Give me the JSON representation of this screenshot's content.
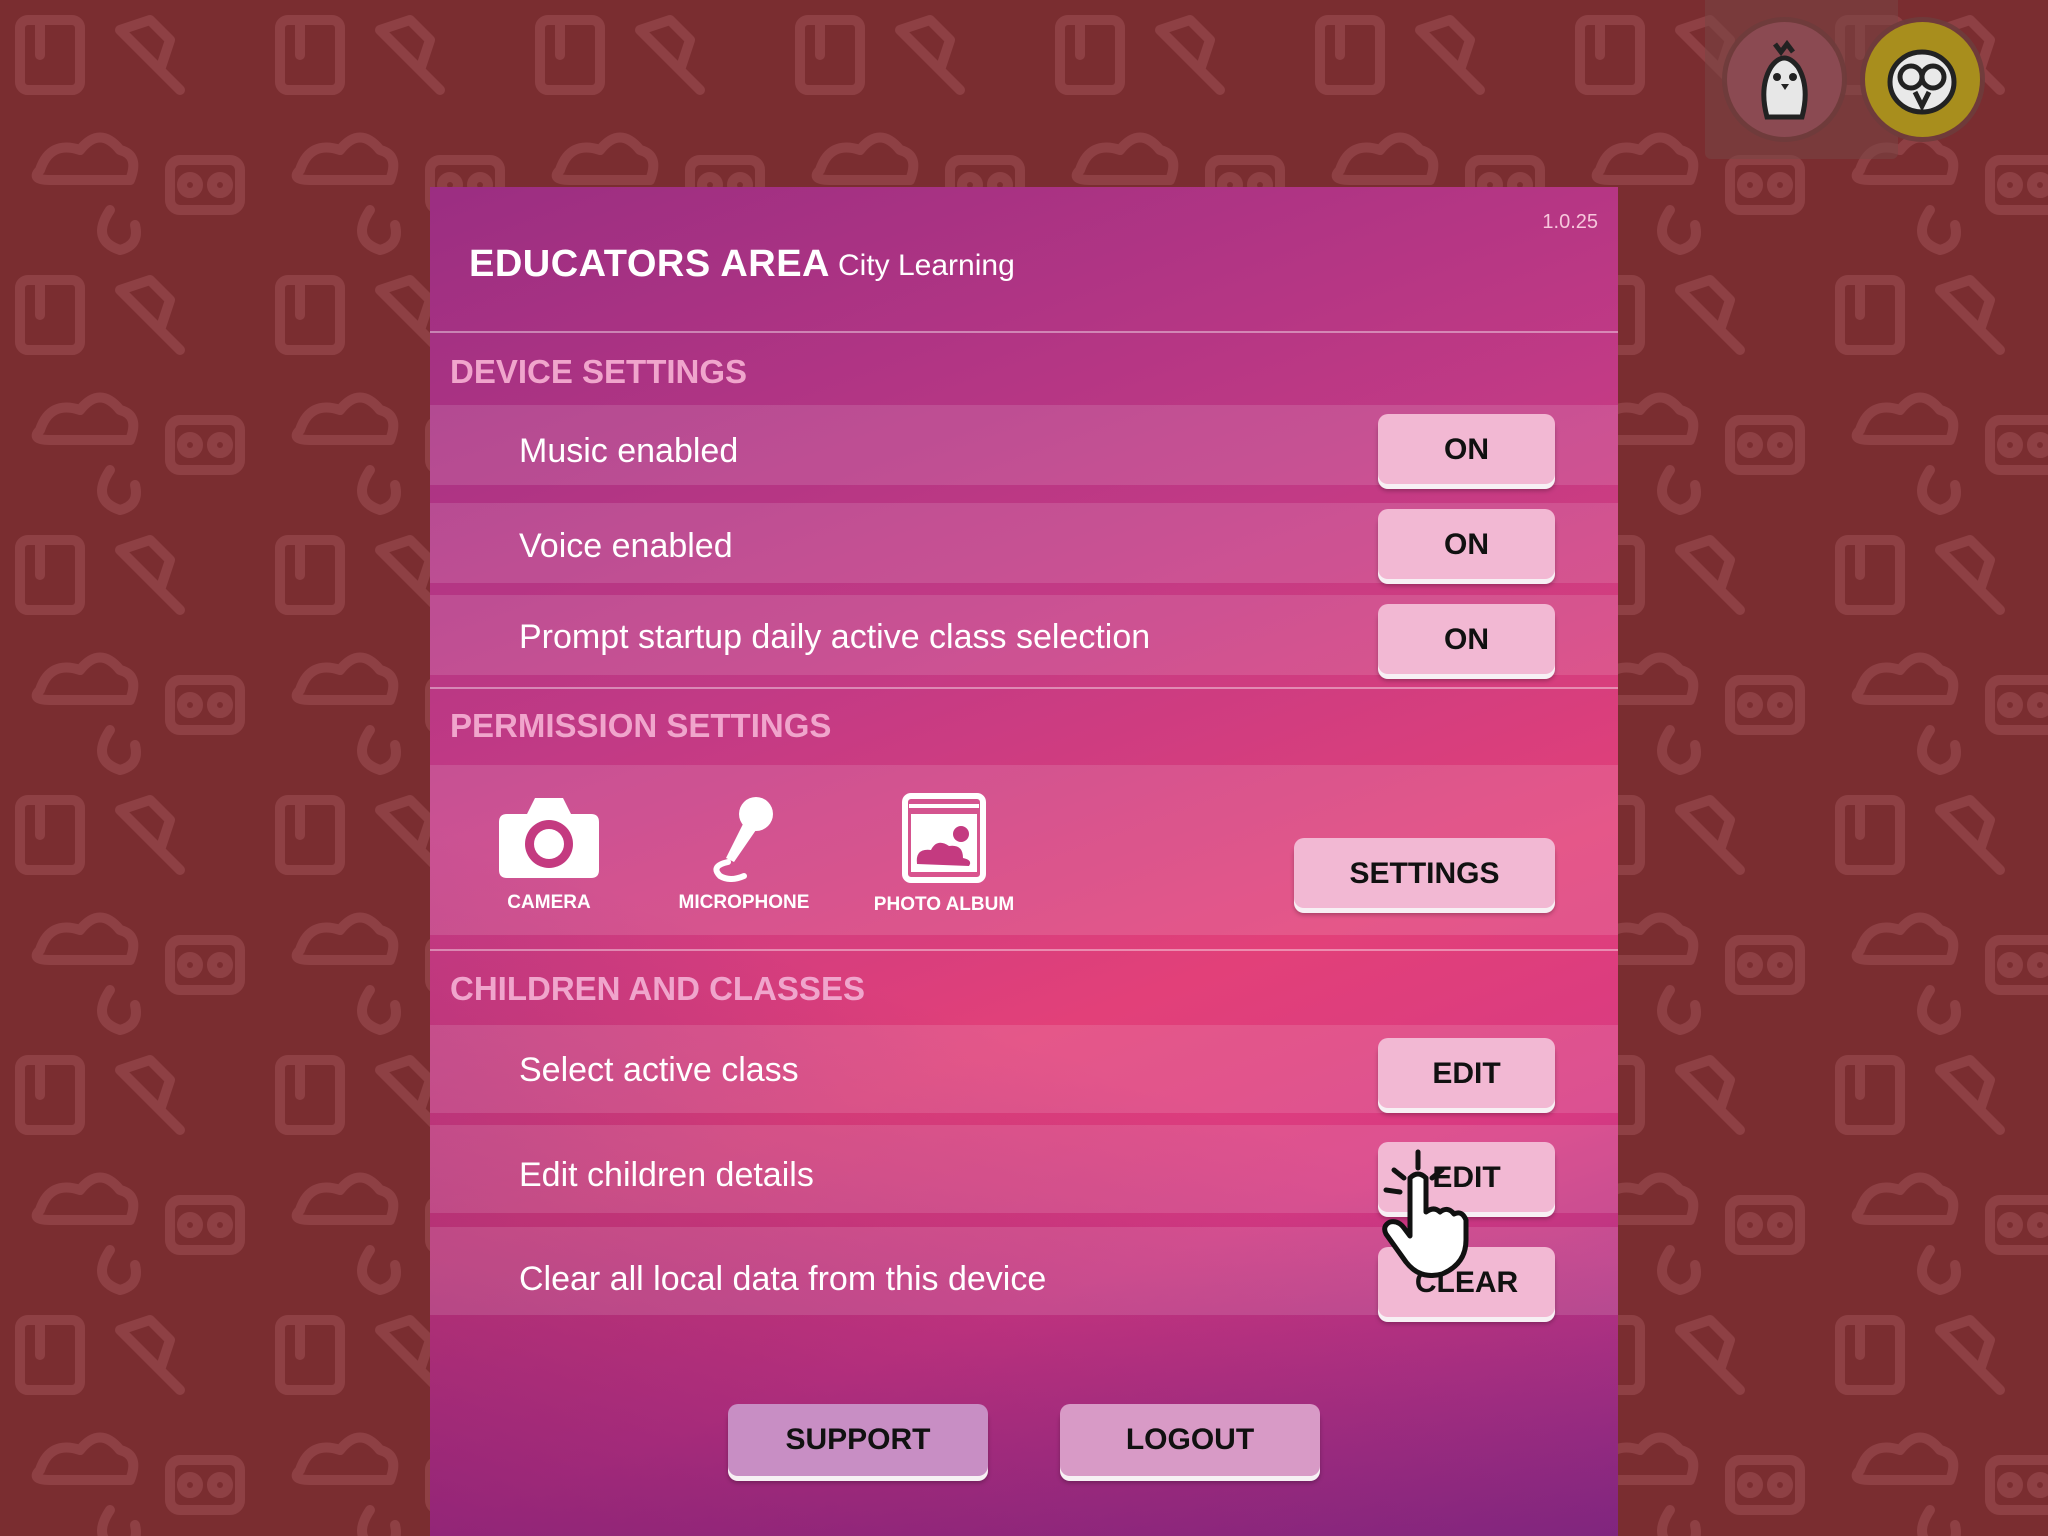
{
  "header": {
    "version": "1.0.25",
    "title": "EDUCATORS AREA",
    "subtitle": "City Learning"
  },
  "device_settings": {
    "title": "DEVICE SETTINGS",
    "rows": [
      {
        "label": "Music enabled",
        "button": "ON"
      },
      {
        "label": "Voice enabled",
        "button": "ON"
      },
      {
        "label": "Prompt startup daily active class selection",
        "button": "ON"
      }
    ]
  },
  "permission_settings": {
    "title": "PERMISSION SETTINGS",
    "items": [
      {
        "label": "CAMERA",
        "icon": "camera-icon"
      },
      {
        "label": "MICROPHONE",
        "icon": "microphone-icon"
      },
      {
        "label": "PHOTO ALBUM",
        "icon": "photo-album-icon"
      }
    ],
    "button": "SETTINGS"
  },
  "children_classes": {
    "title": "CHILDREN AND CLASSES",
    "rows": [
      {
        "label": "Select active class",
        "button": "EDIT"
      },
      {
        "label": "Edit children details",
        "button": "EDIT"
      },
      {
        "label": "Clear all local data from this device",
        "button": "CLEAR"
      }
    ]
  },
  "footer": {
    "support": "SUPPORT",
    "logout": "LOGOUT"
  },
  "colors": {
    "background": "#7a2d30",
    "panel_accent": "#e24079",
    "button": "#f2b8d3",
    "section_title": "#f0a5cc"
  },
  "icons": [
    "chick-avatar-icon",
    "owl-avatar-icon",
    "camera-icon",
    "microphone-icon",
    "photo-album-icon",
    "hand-pointer-icon"
  ]
}
